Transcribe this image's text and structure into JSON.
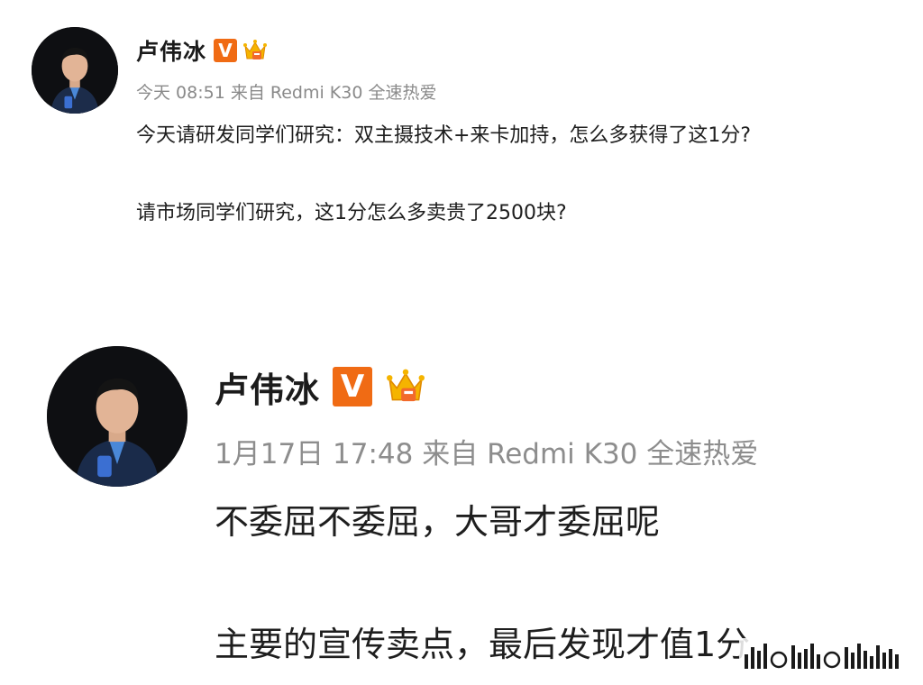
{
  "posts": [
    {
      "author": "卢伟冰",
      "verified_badge": "V",
      "meta": "今天 08:51 来自 Redmi K30 全速热爱",
      "lines": [
        "今天请研发同学们研究：双主摄技术+来卡加持，怎么多获得了这1分?",
        "请市场同学们研究，这1分怎么多卖贵了2500块?"
      ]
    },
    {
      "author": "卢伟冰",
      "verified_badge": "V",
      "meta": "1月17日 17:48 来自 Redmi K30 全速热爱",
      "lines": [
        "不委屈不委屈，大哥才委屈呢",
        "主要的宣传卖点，最后发现才值1分"
      ]
    }
  ],
  "colors": {
    "verified_badge": "#f06b14",
    "crown": "#f5b400",
    "meta_text": "#8a8a8a",
    "body_text": "#1e1e1e"
  },
  "icons": {
    "avatar": "person-avatar-icon",
    "verified": "verified-v-badge-icon",
    "crown": "crown-member-icon",
    "watermark": "bar-signal-watermark-icon"
  }
}
